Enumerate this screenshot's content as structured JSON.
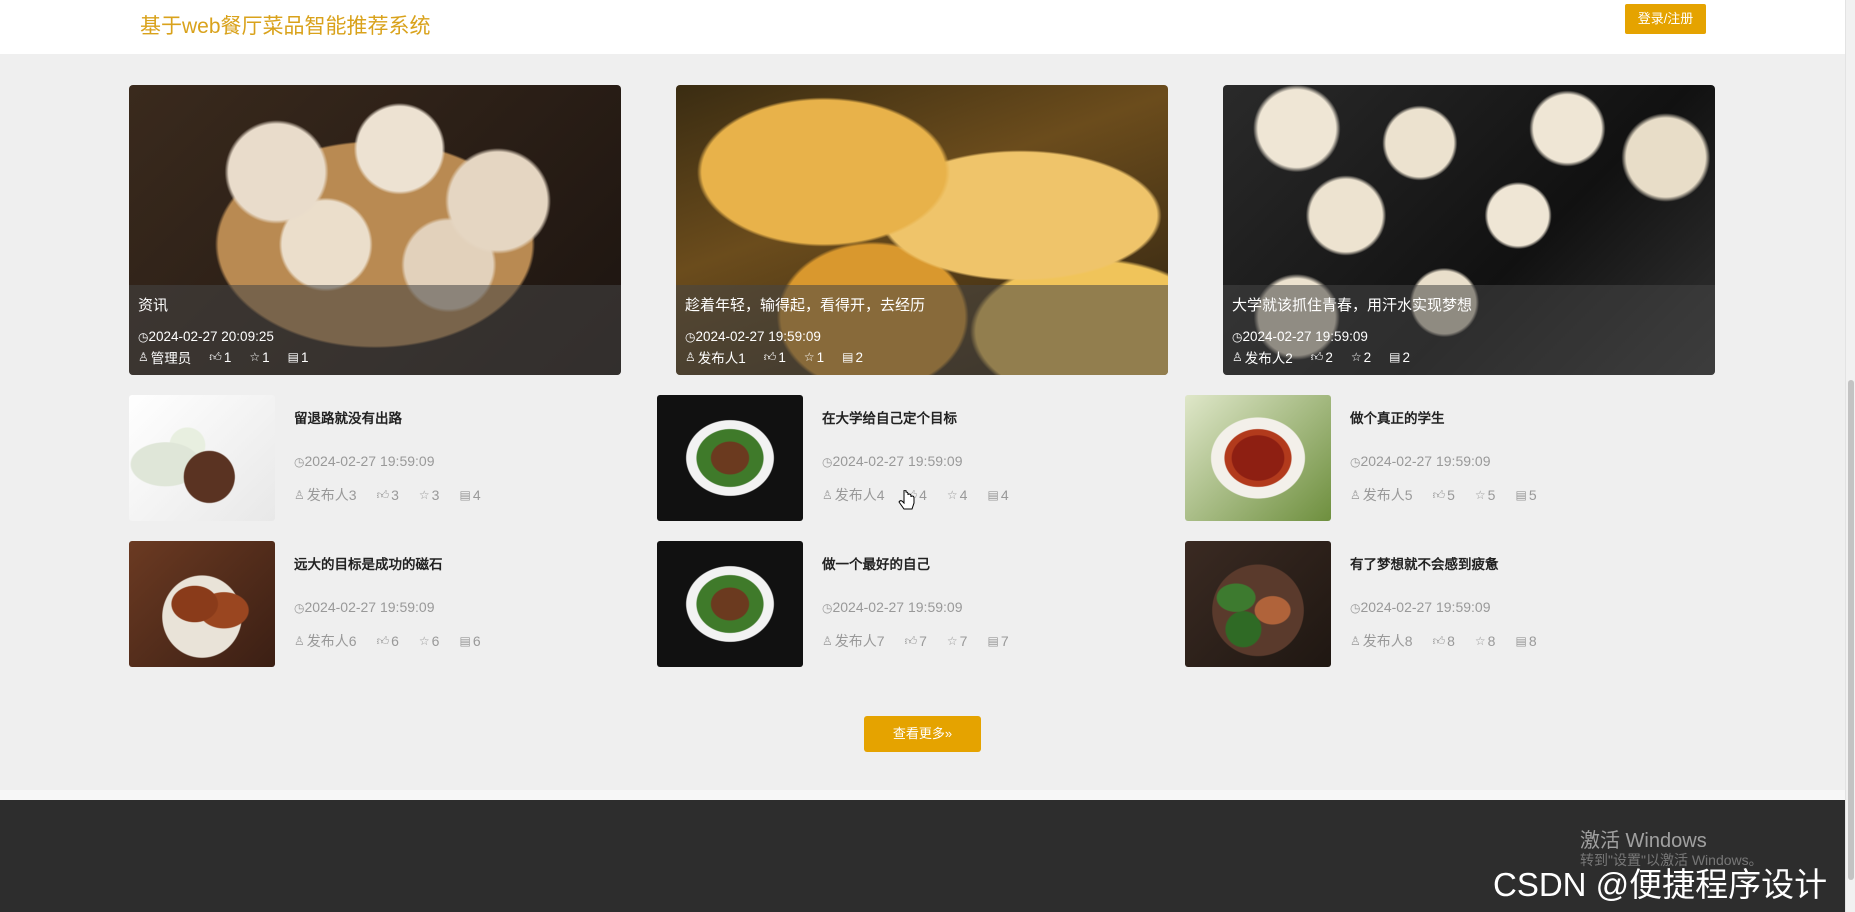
{
  "header": {
    "site_title": "基于web餐厅菜品智能推荐系统",
    "login_label": "登录/注册"
  },
  "featured": [
    {
      "title": "资讯",
      "date": "2024-02-27 20:09:25",
      "author": "管理员",
      "likes": "1",
      "favorites": "1",
      "comments": "1"
    },
    {
      "title": "趁着年轻，输得起，看得开，去经历",
      "date": "2024-02-27 19:59:09",
      "author": "发布人1",
      "likes": "1",
      "favorites": "1",
      "comments": "2"
    },
    {
      "title": "大学就该抓住青春，用汗水实现梦想",
      "date": "2024-02-27 19:59:09",
      "author": "发布人2",
      "likes": "2",
      "favorites": "2",
      "comments": "2"
    }
  ],
  "cards": [
    {
      "title": "留退路就没有出路",
      "date": "2024-02-27 19:59:09",
      "author": "发布人3",
      "likes": "3",
      "favorites": "3",
      "comments": "4"
    },
    {
      "title": "在大学给自己定个目标",
      "date": "2024-02-27 19:59:09",
      "author": "发布人4",
      "likes": "4",
      "favorites": "4",
      "comments": "4"
    },
    {
      "title": "做个真正的学生",
      "date": "2024-02-27 19:59:09",
      "author": "发布人5",
      "likes": "5",
      "favorites": "5",
      "comments": "5"
    },
    {
      "title": "远大的目标是成功的磁石",
      "date": "2024-02-27 19:59:09",
      "author": "发布人6",
      "likes": "6",
      "favorites": "6",
      "comments": "6"
    },
    {
      "title": "做一个最好的自己",
      "date": "2024-02-27 19:59:09",
      "author": "发布人7",
      "likes": "7",
      "favorites": "7",
      "comments": "7"
    },
    {
      "title": "有了梦想就不会感到疲惫",
      "date": "2024-02-27 19:59:09",
      "author": "发布人8",
      "likes": "8",
      "favorites": "8",
      "comments": "8"
    }
  ],
  "more_label": "查看更多»",
  "watermark": {
    "activate_title": "激活 Windows",
    "activate_hint": "转到\"设置\"以激活 Windows。",
    "csdn": "CSDN @便捷程序设计"
  },
  "icons": {
    "time": "clock-icon",
    "author": "user-icon",
    "likes": "thumbs-up-icon",
    "favorites": "star-icon",
    "comments": "comment-icon"
  },
  "colors": {
    "accent": "#e5a300",
    "title": "#d9a21b",
    "footer": "#2d2d2d",
    "background": "#efefef"
  }
}
